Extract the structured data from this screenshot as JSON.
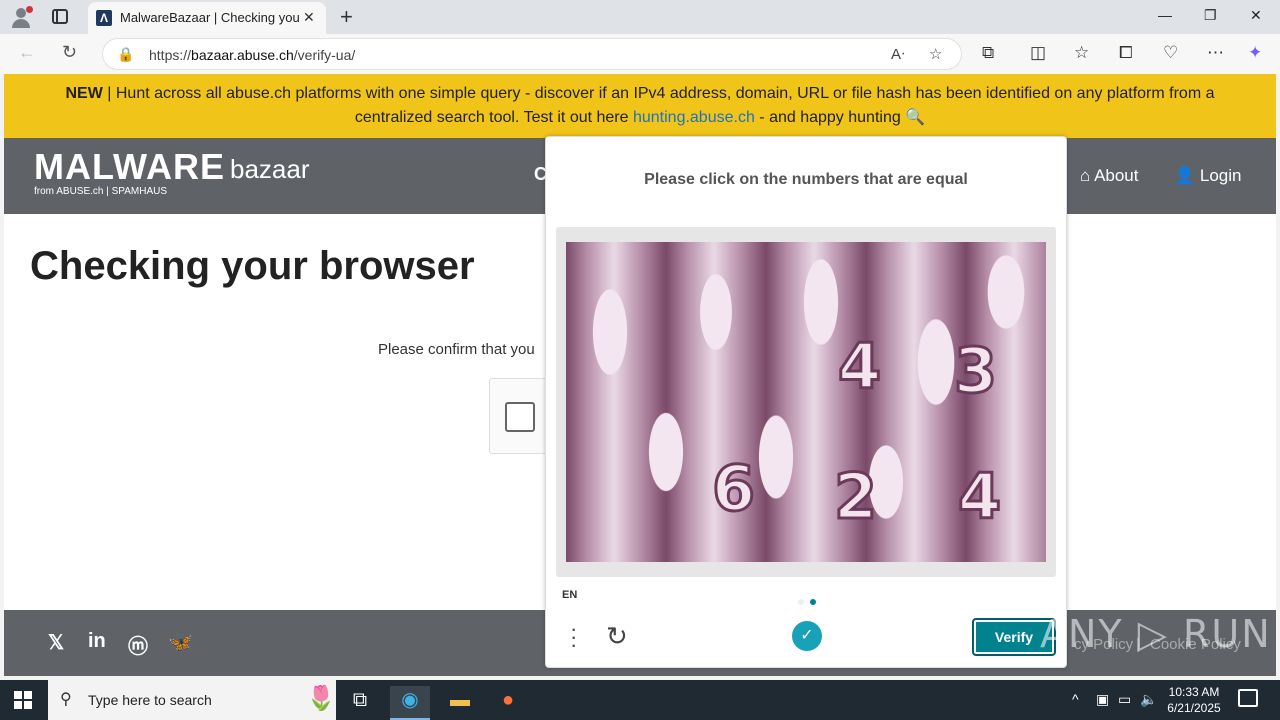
{
  "browser": {
    "tab_title": "MalwareBazaar | Checking your browser",
    "tab_favicon": "Λ",
    "url_prefix": "https://",
    "url_host": "bazaar.abuse.ch",
    "url_path": "/verify-ua/"
  },
  "banner": {
    "new_label": "NEW",
    "text_before": " | Hunt across all abuse.ch platforms with one simple query - discover if an IPv4 address, domain, URL or file hash has been identified on any platform from a centralized search tool. Test it out here ",
    "link_text": "hunting.abuse.ch",
    "text_after": " - and happy hunting 🔍"
  },
  "header": {
    "logo_main": "MALWARE",
    "logo_sub": "bazaar",
    "logo_from": "from ABUSE.ch | SPAMHAUS",
    "nav_cut": "C",
    "nav_about": "About",
    "nav_login": "Login"
  },
  "main": {
    "heading": "Checking your browser",
    "confirm_text": "Please confirm that you"
  },
  "footer": {
    "policy_left": "cy Policy",
    "sep": "|",
    "policy_right": "Cookie Policy"
  },
  "captcha": {
    "prompt": "Please click on the numbers that are equal",
    "numbers": [
      "4",
      "3",
      "6",
      "2",
      "4"
    ],
    "language": "EN",
    "verify_label": "Verify",
    "accent_color": "#00838f"
  },
  "watermark": "ANY ▷ RUN",
  "taskbar": {
    "search_placeholder": "Type here to search",
    "time": "10:33 AM",
    "date": "6/21/2025"
  }
}
